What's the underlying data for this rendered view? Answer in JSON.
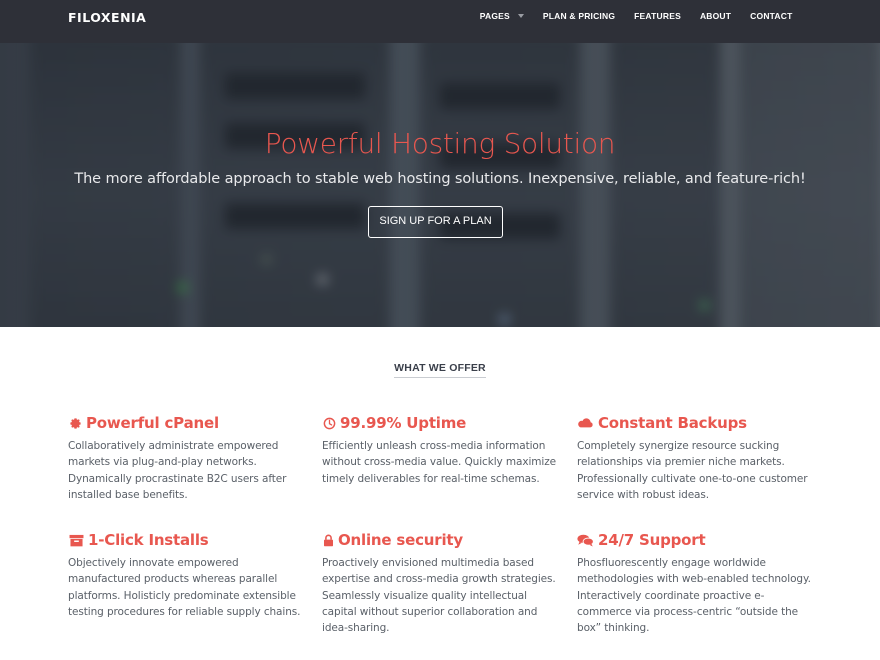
{
  "brand": {
    "logo": "FILOXENIA"
  },
  "nav": {
    "items": [
      {
        "label": "PAGES",
        "has_dropdown": true
      },
      {
        "label": "PLAN & PRICING"
      },
      {
        "label": "FEATURES"
      },
      {
        "label": "ABOUT"
      },
      {
        "label": "CONTACT"
      }
    ]
  },
  "hero": {
    "title": "Powerful Hosting Solution",
    "subtitle": "The more affordable approach to stable web hosting solutions. Inexpensive, reliable, and feature-rich!",
    "cta_label": "SIGN UP FOR A PLAN"
  },
  "offer": {
    "section_title": "WHAT WE OFFER",
    "features": [
      {
        "icon": "gear-icon",
        "title": "Powerful cPanel",
        "text": "Collaboratively administrate empowered markets via plug-and-play networks. Dynamically procrastinate B2C users after installed base benefits."
      },
      {
        "icon": "clock-icon",
        "title": "99.99% Uptime",
        "text": "Efficiently unleash cross-media information without cross-media value. Quickly maximize timely deliverables for real-time schemas."
      },
      {
        "icon": "cloud-icon",
        "title": "Constant Backups",
        "text": "Completely synergize resource sucking relationships via premier niche markets. Professionally cultivate one-to-one customer service with robust ideas."
      },
      {
        "icon": "archive-icon",
        "title": "1-Click Installs",
        "text": "Objectively innovate empowered manufactured products whereas parallel platforms. Holisticly predominate extensible testing procedures for reliable supply chains."
      },
      {
        "icon": "lock-icon",
        "title": "Online security",
        "text": "Proactively envisioned multimedia based expertise and cross-media growth strategies. Seamlessly visualize quality intellectual capital without superior collaboration and idea-sharing."
      },
      {
        "icon": "comments-icon",
        "title": "24/7 Support",
        "text": "Phosfluorescently engage worldwide methodologies with web-enabled technology. Interactively coordinate proactive e-commerce via process-centric “outside the box” thinking."
      }
    ]
  },
  "colors": {
    "accent": "#e8574f",
    "navbar": "#2e3038",
    "body_text": "#5a6068"
  }
}
